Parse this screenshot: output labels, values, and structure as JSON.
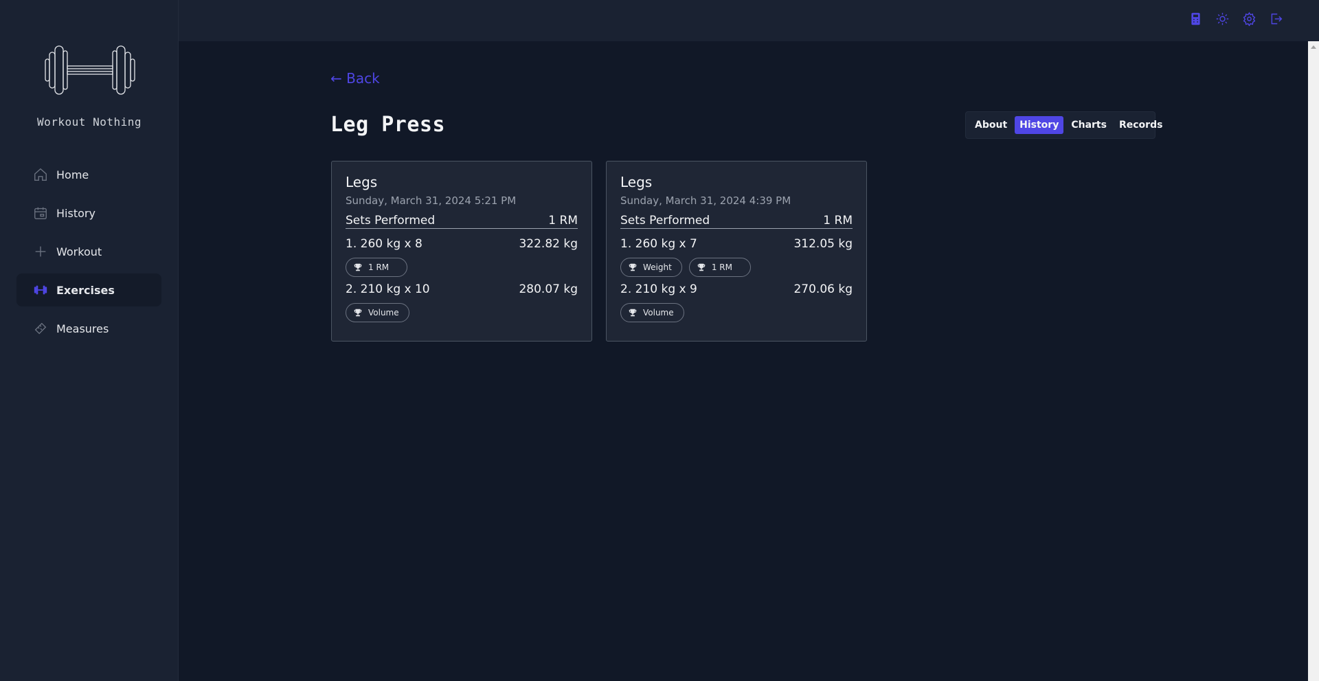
{
  "app": {
    "brand": "Workout Nothing",
    "accent_color": "#4f46e5"
  },
  "sidebar": {
    "items": [
      {
        "label": "Home",
        "icon": "home-icon"
      },
      {
        "label": "History",
        "icon": "calendar-icon"
      },
      {
        "label": "Workout",
        "icon": "plus-icon"
      },
      {
        "label": "Exercises",
        "icon": "dumbbell-icon",
        "active": true
      },
      {
        "label": "Measures",
        "icon": "ruler-icon"
      }
    ]
  },
  "topbar": {
    "icons": [
      "calculator-icon",
      "sun-icon",
      "gear-icon",
      "logout-icon"
    ]
  },
  "main": {
    "back_label": "← Back",
    "title": "Leg Press",
    "tabs": [
      {
        "label": "About"
      },
      {
        "label": "History",
        "active": true
      },
      {
        "label": "Charts"
      },
      {
        "label": "Records"
      }
    ],
    "cards": [
      {
        "title": "Legs",
        "date": "Sunday, March 31, 2024 5:21 PM",
        "header_left": "Sets Performed",
        "header_right": "1 RM",
        "sets": [
          {
            "label": "1. 260 kg x 8",
            "value": "322.82 kg",
            "badges": [
              "1 RM"
            ]
          },
          {
            "label": "2. 210 kg x 10",
            "value": "280.07 kg",
            "badges": [
              "Volume"
            ]
          }
        ]
      },
      {
        "title": "Legs",
        "date": "Sunday, March 31, 2024 4:39 PM",
        "header_left": "Sets Performed",
        "header_right": "1 RM",
        "sets": [
          {
            "label": "1. 260 kg x 7",
            "value": "312.05 kg",
            "badges": [
              "Weight",
              "1 RM"
            ]
          },
          {
            "label": "2. 210 kg x 9",
            "value": "270.06 kg",
            "badges": [
              "Volume"
            ]
          }
        ]
      }
    ]
  }
}
